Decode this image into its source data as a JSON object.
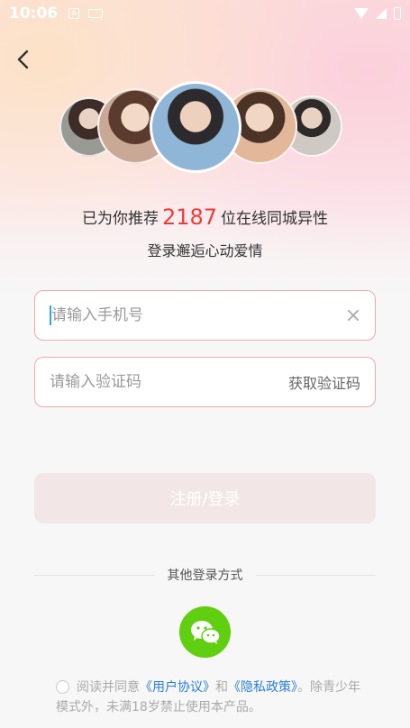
{
  "status_bar": {
    "time": "10:06"
  },
  "hero": {
    "prefix": "已为你推荐",
    "count": "2187",
    "suffix": "位在线同城异性",
    "subtitle": "登录邂逅心动爱情"
  },
  "form": {
    "phone_placeholder": "请输入手机号",
    "code_placeholder": "请输入验证码",
    "get_code_label": "获取验证码",
    "submit_label": "注册/登录"
  },
  "other_login": {
    "label": "其他登录方式"
  },
  "agreement": {
    "text_1": "阅读并同意",
    "user_agreement": "《用户协议》",
    "and": "和",
    "privacy_policy": "《隐私政策》",
    "text_2": "。除青少年模式外，未满18岁禁止使用本产品。"
  },
  "colors": {
    "accent_count": "#ef3a3a",
    "field_border": "#f1a9a9",
    "wechat_green": "#5fcf0f",
    "link": "#2b7fd8"
  }
}
